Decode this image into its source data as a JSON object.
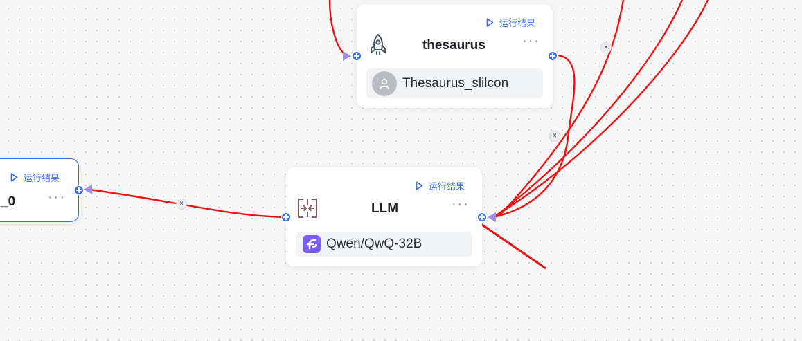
{
  "colors": {
    "accent": "#3b6fe8",
    "edge": "#ee1111",
    "annotation": "#ee1111",
    "arrowhead": "#9a8fe0"
  },
  "run_label": "运行结果",
  "more_label": "···",
  "edge_delete_label": "×",
  "nodes": {
    "left": {
      "title": "_0"
    },
    "thesaurus": {
      "title": "thesaurus",
      "icon": "rocket-icon",
      "chip_icon": "user-avatar-icon",
      "chip_label": "Thesaurus_slilcon"
    },
    "llm": {
      "title": "LLM",
      "icon": "llm-merge-icon",
      "chip_icon": "siliconflow-logo-icon",
      "chip_label": "Qwen/QwQ-32B"
    }
  }
}
